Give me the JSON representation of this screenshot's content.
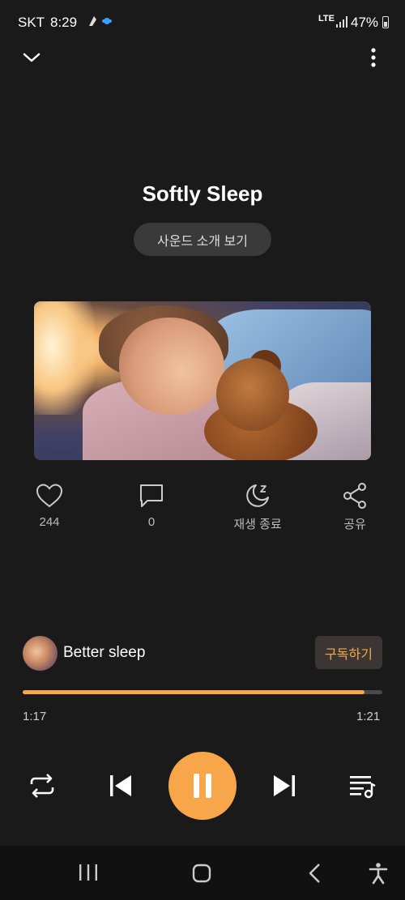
{
  "status_bar": {
    "carrier": "SKT",
    "time": "8:29",
    "network": "LTE",
    "battery": "47%"
  },
  "player": {
    "title": "Softly Sleep",
    "intro_button": "사운드 소개 보기",
    "actions": {
      "like_count": "244",
      "comment_count": "0",
      "sleep_timer": "재생 종료",
      "share": "공유"
    },
    "playlist": {
      "name": "Better sleep",
      "subscribe": "구독하기"
    },
    "progress": {
      "elapsed": "1:17",
      "duration": "1:21",
      "fraction": 0.95
    }
  },
  "colors": {
    "accent": "#f7a64a",
    "background": "#1a1a1a"
  },
  "icons": [
    "chevron-down-icon",
    "more-vertical-icon",
    "heart-icon",
    "comment-icon",
    "moon-sleep-icon",
    "share-icon",
    "repeat-icon",
    "skip-previous-icon",
    "pause-icon",
    "skip-next-icon",
    "playlist-music-icon",
    "recent-apps-icon",
    "home-icon",
    "back-icon",
    "accessibility-icon"
  ]
}
